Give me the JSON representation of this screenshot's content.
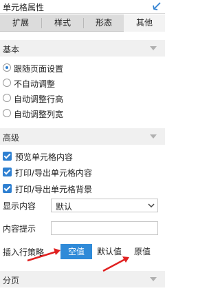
{
  "panel": {
    "title": "单元格属性"
  },
  "tabs": [
    {
      "label": "扩展",
      "active": false
    },
    {
      "label": "样式",
      "active": false
    },
    {
      "label": "形态",
      "active": false
    },
    {
      "label": "其他",
      "active": true
    }
  ],
  "basic": {
    "title": "基本",
    "options": [
      {
        "label": "跟随页面设置",
        "selected": true
      },
      {
        "label": "不自动调整",
        "selected": false
      },
      {
        "label": "自动调整行高",
        "selected": false
      },
      {
        "label": "自动调整列宽",
        "selected": false
      }
    ]
  },
  "advanced": {
    "title": "高级",
    "checkboxes": [
      {
        "label": "预览单元格内容",
        "checked": true
      },
      {
        "label": "打印/导出单元格内容",
        "checked": true
      },
      {
        "label": "打印/导出单元格背景",
        "checked": true
      }
    ],
    "display_content": {
      "label": "显示内容",
      "value": "默认"
    },
    "content_hint": {
      "label": "内容提示",
      "value": ""
    },
    "insert_row_policy": {
      "label": "插入行策略",
      "options": [
        {
          "label": "空值",
          "active": true
        },
        {
          "label": "默认值",
          "active": false
        },
        {
          "label": "原值",
          "active": false
        }
      ]
    }
  },
  "paging": {
    "title": "分页"
  },
  "colors": {
    "accent": "#2f8ad8",
    "annotation_arrow": "#e02020"
  },
  "icons": {
    "pin": "pin-arrow-icon",
    "dropdown": "chevron-down-icon",
    "collapse": "caret-down-icon"
  }
}
